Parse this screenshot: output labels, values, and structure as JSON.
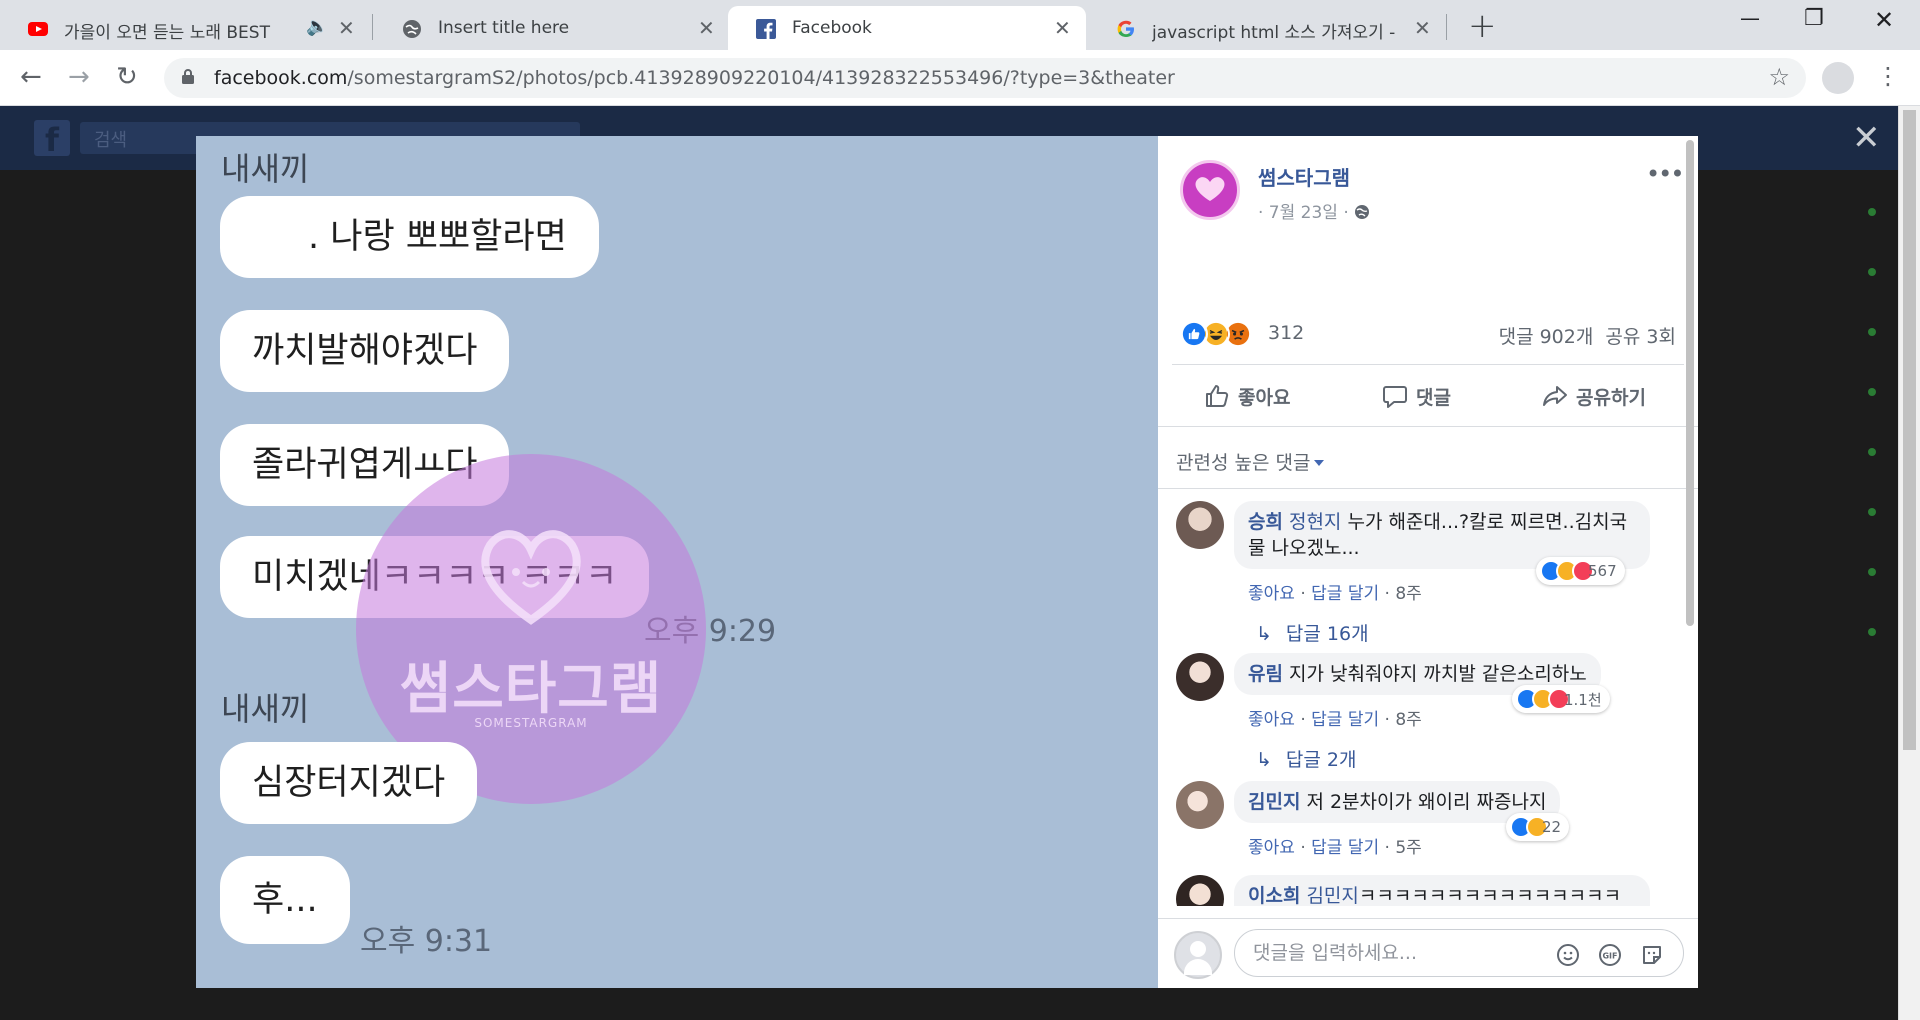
{
  "browser": {
    "tabs": [
      {
        "title": "가을이 오면 듣는 노래 BEST",
        "icon": "youtube-icon"
      },
      {
        "title": "Insert title here",
        "icon": "globe-icon"
      },
      {
        "title": "Facebook",
        "icon": "facebook-icon"
      },
      {
        "title": "javascript html 소스 가져오기 -",
        "icon": "google-icon"
      }
    ],
    "url_host": "facebook.com",
    "url_path": "/somestargramS2/photos/pcb.413928909220104/413928322553496/?type=3&theater"
  },
  "fb": {
    "search_placeholder": "검색"
  },
  "photo": {
    "sender1": "내새끼",
    "bubbles1": [
      ". 나랑 뽀뽀할라면",
      "까치발해야겠다",
      "졸라귀엽게ㅛ다",
      "미치겠네ㅋㅋㅋㅋ ㅋㅋㅋ"
    ],
    "time1": "오후 9:29",
    "sender2": "내새끼",
    "bubbles2": [
      "심장터지겠다",
      "후..."
    ],
    "time2": "오후 9:31",
    "watermark": "썸스타그램",
    "watermark_sub": "SOMESTARGRAM"
  },
  "post": {
    "page_name": "썸스타그램",
    "date": "· 7월 23일 ·",
    "reaction_count": "312",
    "stats": "댓글 902개  공유 3회",
    "actions": {
      "like": "좋아요",
      "comment": "댓글",
      "share": "공유하기"
    },
    "sort_label": "관련성 높은 댓글"
  },
  "comments": [
    {
      "author": "승희",
      "mention": "정현지",
      "text": " 누가 해준대...?칼로 찌르면..김치국물 나오겠노...",
      "like": "좋아요",
      "reply": "답글 달기",
      "time": "8주",
      "reactions": "567",
      "replies": "답글 16개"
    },
    {
      "author": "유림",
      "mention": "",
      "text": "지가 낮춰줘야지 까치발 같은소리하노",
      "like": "좋아요",
      "reply": "답글 달기",
      "time": "8주",
      "reactions": "1.1천",
      "replies": "답글 2개"
    },
    {
      "author": "김민지",
      "mention": "",
      "text": "저 2분차이가 왜이리 짜증나지",
      "like": "좋아요",
      "reply": "답글 달기",
      "time": "5주",
      "reactions": "22",
      "replies": ""
    },
    {
      "author": "이소희",
      "mention": "김민지",
      "text": "ㅋㅋㅋㅋㅋㅋㅋㅋㅋㅋㅋㅋㅋㅋㅋㅋㅋㅋㅋㅋㅋㅋㅋㅋㅋㅋㅋ ㅠㅠ혼자 상상하고 후",
      "like": "",
      "reply": "",
      "time": "",
      "reactions": "",
      "replies": ""
    }
  ],
  "composer": {
    "placeholder": "댓글을 입력하세요..."
  },
  "colors": {
    "fb_blue": "#385898",
    "like_blue": "#1877f2",
    "haha_yellow": "#f7b125",
    "angry_orange": "#e9710f",
    "love_red": "#f33e58"
  }
}
